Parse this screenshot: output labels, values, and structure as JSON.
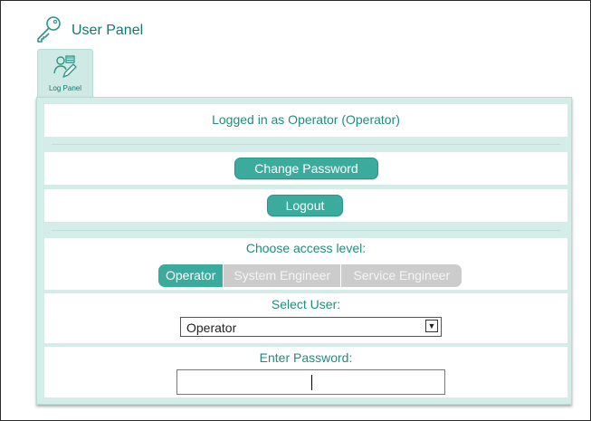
{
  "header": {
    "title": "User Panel",
    "icon": "key-icon"
  },
  "tabs": [
    {
      "label": "Log Panel",
      "icon": "user-edit-icon",
      "active": true
    }
  ],
  "panel": {
    "status_text": "Logged in as Operator (Operator)",
    "change_password_label": "Change Password",
    "logout_label": "Logout",
    "access_level": {
      "label": "Choose access level:",
      "options": [
        "Operator",
        "System Engineer",
        "Service Engineer"
      ],
      "selected": "Operator"
    },
    "select_user": {
      "label": "Select User:",
      "value": "Operator"
    },
    "password": {
      "label": "Enter Password:",
      "value": ""
    }
  },
  "colors": {
    "accent": "#3aab9d",
    "text_accent": "#1f8c7f",
    "panel_bg": "#d5ede8",
    "inactive": "#cccccc"
  }
}
